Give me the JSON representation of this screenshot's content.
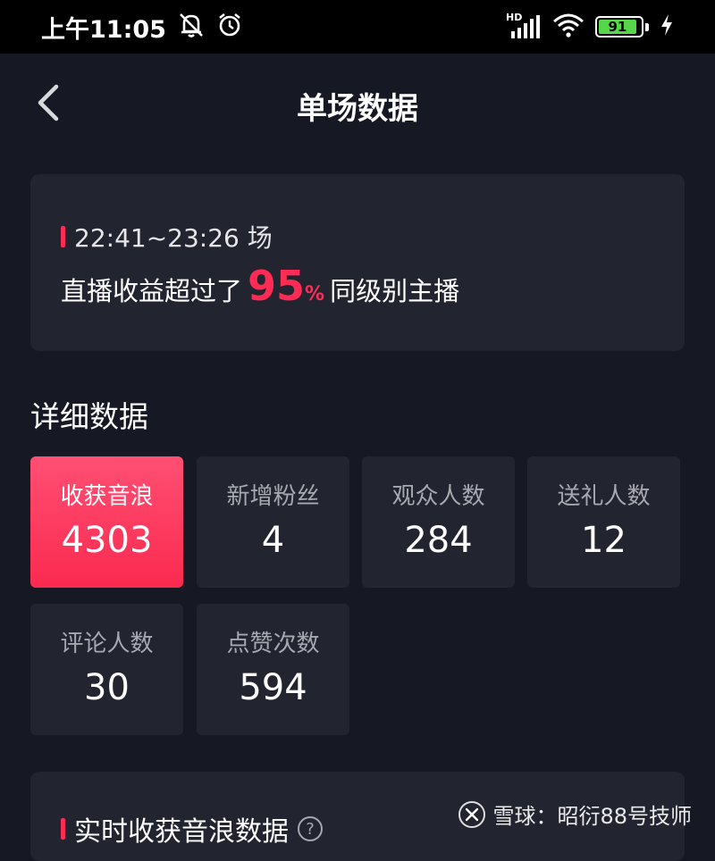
{
  "status_bar": {
    "time": "上午11:05",
    "network_label": "HD",
    "battery_level": "91",
    "battery_fraction": 0.91
  },
  "nav": {
    "title": "单场数据",
    "back_icon": "chevron-left-icon"
  },
  "summary": {
    "session": "22:41~23:26 场",
    "ranking_prefix": "直播收益超过了",
    "ranking_value": "95",
    "ranking_unit": "%",
    "ranking_suffix": "同级别主播"
  },
  "details": {
    "title": "详细数据",
    "metrics": [
      {
        "label": "收获音浪",
        "value": "4303"
      },
      {
        "label": "新增粉丝",
        "value": "4"
      },
      {
        "label": "观众人数",
        "value": "284"
      },
      {
        "label": "送礼人数",
        "value": "12"
      },
      {
        "label": "评论人数",
        "value": "30"
      },
      {
        "label": "点赞次数",
        "value": "594"
      }
    ]
  },
  "realtime": {
    "title": "实时收获音浪数据",
    "help_icon": "question-mark-icon"
  },
  "watermark": {
    "text": "雪球：昭衍88号技师"
  },
  "colors": {
    "accent": "#fe2c55",
    "background": "#161823",
    "card": "#222430",
    "battery": "#58d64a"
  }
}
